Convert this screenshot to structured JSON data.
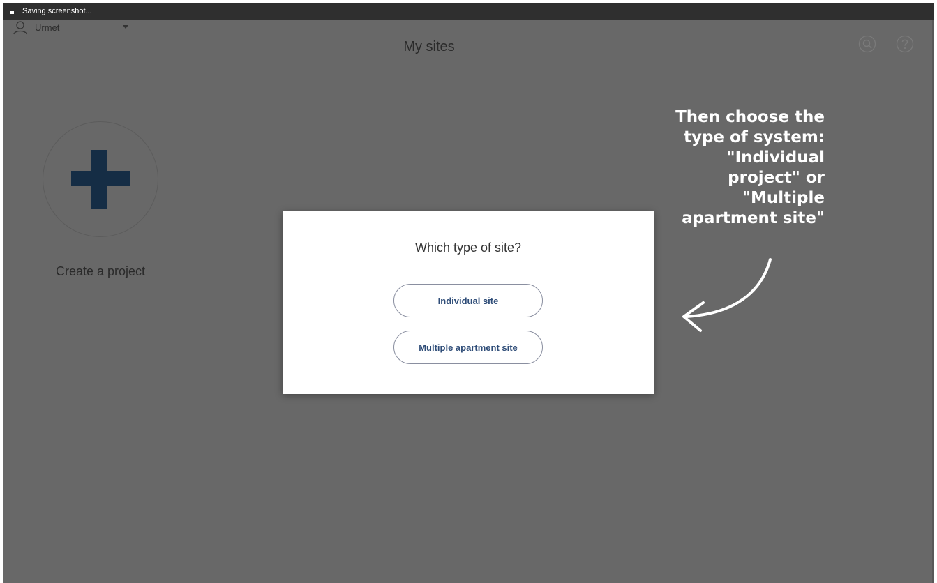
{
  "status_bar": {
    "text": "Saving screenshot..."
  },
  "header": {
    "user_name": "Urmet",
    "title": "My sites"
  },
  "create_project": {
    "label": "Create a project"
  },
  "dialog": {
    "title": "Which type of site?",
    "option_individual": "Individual site",
    "option_multiple": "Multiple apartment site"
  },
  "annotation": {
    "lines": [
      "Then choose the",
      "type of system:",
      "\"Individual",
      "project\" or",
      "\"Multiple",
      "apartment site\""
    ]
  },
  "colors": {
    "overlay_background": "#686868",
    "plus_icon": "#152d45",
    "button_text": "#2f4d78",
    "status_bar": "#2f2f2f"
  }
}
